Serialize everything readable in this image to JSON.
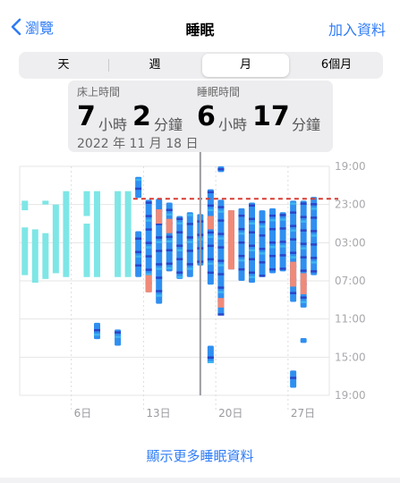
{
  "nav": {
    "back_label": "瀏覽",
    "title": "睡眠",
    "add_label": "加入資料"
  },
  "segments": [
    "天",
    "週",
    "月",
    "6個月"
  ],
  "selected_segment": "月",
  "callout": {
    "in_bed_label": "床上時間",
    "in_bed_hours": "7",
    "in_bed_hours_unit": "小時",
    "in_bed_minutes": "2",
    "in_bed_minutes_unit": "分鐘",
    "asleep_label": "睡眠時間",
    "asleep_hours": "6",
    "asleep_hours_unit": "小時",
    "asleep_minutes": "17",
    "asleep_minutes_unit": "分鐘",
    "date": "2022 年 11 月 18 日"
  },
  "more_label": "顯示更多睡眠資料",
  "colors": {
    "accent": "#2f7cf6",
    "in_bed": "#7ee6e6",
    "core": "#2f8ff0",
    "deep": "#2a45c8",
    "awake": "#f08a78",
    "rem": "#3fb5f0",
    "average_line": "#d93a30"
  },
  "chart_data": {
    "type": "sleep-range",
    "y_ticks": [
      "19:00",
      "23:00",
      "03:00",
      "07:00",
      "11:00",
      "15:00",
      "19:00"
    ],
    "x_ticks": [
      "6日",
      "13日",
      "20日",
      "27日"
    ],
    "x_tick_days": [
      6,
      13,
      20,
      27
    ],
    "x_range_days": [
      0.5,
      30.5
    ],
    "y_range_hours_from_19": [
      0,
      24
    ],
    "selected_day": 18,
    "average_line_hours_from_19": 3.4,
    "in_bed_days": [
      {
        "day": 1,
        "segments": [
          [
            3.6,
            4.6
          ],
          [
            6.4,
            11.4
          ]
        ]
      },
      {
        "day": 2,
        "segments": [
          [
            6.6,
            12.2
          ]
        ]
      },
      {
        "day": 3,
        "segments": [
          [
            3.6,
            4.0
          ],
          [
            7.0,
            11.8
          ]
        ]
      },
      {
        "day": 4,
        "segments": [
          [
            4.0,
            11.2
          ]
        ]
      },
      {
        "day": 5,
        "segments": [
          [
            2.6,
            11.6
          ]
        ]
      },
      {
        "day": 7,
        "segments": [
          [
            2.6,
            5.2
          ],
          [
            6.0,
            11.6
          ]
        ]
      },
      {
        "day": 8,
        "segments": [
          [
            2.6,
            11.6
          ]
        ]
      },
      {
        "day": 10,
        "segments": [
          [
            2.6,
            11.6
          ]
        ]
      },
      {
        "day": 11,
        "segments": [
          [
            2.6,
            11.6
          ]
        ]
      }
    ],
    "asleep_days": [
      {
        "day": 8,
        "start": 16.4,
        "end": 18.1,
        "awake": []
      },
      {
        "day": 10,
        "start": 17.1,
        "end": 18.8,
        "awake": []
      },
      {
        "day": 12,
        "start": 1.1,
        "end": 3.3,
        "awake": []
      },
      {
        "day": 12,
        "start": 6.8,
        "end": 11.6,
        "awake": []
      },
      {
        "day": 13,
        "start": 3.5,
        "end": 13.2,
        "awake": [
          [
            11.4,
            13.2
          ]
        ]
      },
      {
        "day": 14,
        "start": 3.4,
        "end": 14.4,
        "awake": [
          [
            4.5,
            6.0
          ]
        ]
      },
      {
        "day": 15,
        "start": 3.8,
        "end": 11.0,
        "awake": [
          [
            5.5,
            7.0
          ]
        ]
      },
      {
        "day": 16,
        "start": 5.2,
        "end": 11.8,
        "awake": []
      },
      {
        "day": 17,
        "start": 4.8,
        "end": 11.6,
        "awake": []
      },
      {
        "day": 18,
        "start": 5.0,
        "end": 10.4,
        "awake": []
      },
      {
        "day": 19,
        "start": 2.4,
        "end": 12.4,
        "awake": [
          [
            5.2,
            6.6
          ]
        ]
      },
      {
        "day": 19,
        "start": 18.8,
        "end": 20.6,
        "awake": []
      },
      {
        "day": 20,
        "start": 3.5,
        "end": 15.6,
        "awake": [
          [
            13.8,
            14.8
          ]
        ]
      },
      {
        "day": 20,
        "start": 0.0,
        "end": 0.6,
        "awake": []
      },
      {
        "day": 21,
        "start": 4.6,
        "end": 10.8,
        "awake": [
          [
            4.6,
            10.8
          ]
        ]
      },
      {
        "day": 22,
        "start": 4.4,
        "end": 12.0,
        "awake": []
      },
      {
        "day": 23,
        "start": 3.8,
        "end": 12.2,
        "awake": []
      },
      {
        "day": 24,
        "start": 4.6,
        "end": 11.6,
        "awake": []
      },
      {
        "day": 25,
        "start": 4.4,
        "end": 11.2,
        "awake": []
      },
      {
        "day": 26,
        "start": 4.8,
        "end": 11.0,
        "awake": []
      },
      {
        "day": 27,
        "start": 3.6,
        "end": 14.2,
        "awake": [
          [
            10.0,
            12.6
          ]
        ]
      },
      {
        "day": 27,
        "start": 21.4,
        "end": 23.2,
        "awake": []
      },
      {
        "day": 28,
        "start": 3.6,
        "end": 14.8,
        "awake": [
          [
            11.2,
            13.4
          ]
        ]
      },
      {
        "day": 28,
        "start": 18.0,
        "end": 18.5,
        "awake": []
      },
      {
        "day": 29,
        "start": 3.2,
        "end": 11.4,
        "awake": []
      }
    ]
  }
}
